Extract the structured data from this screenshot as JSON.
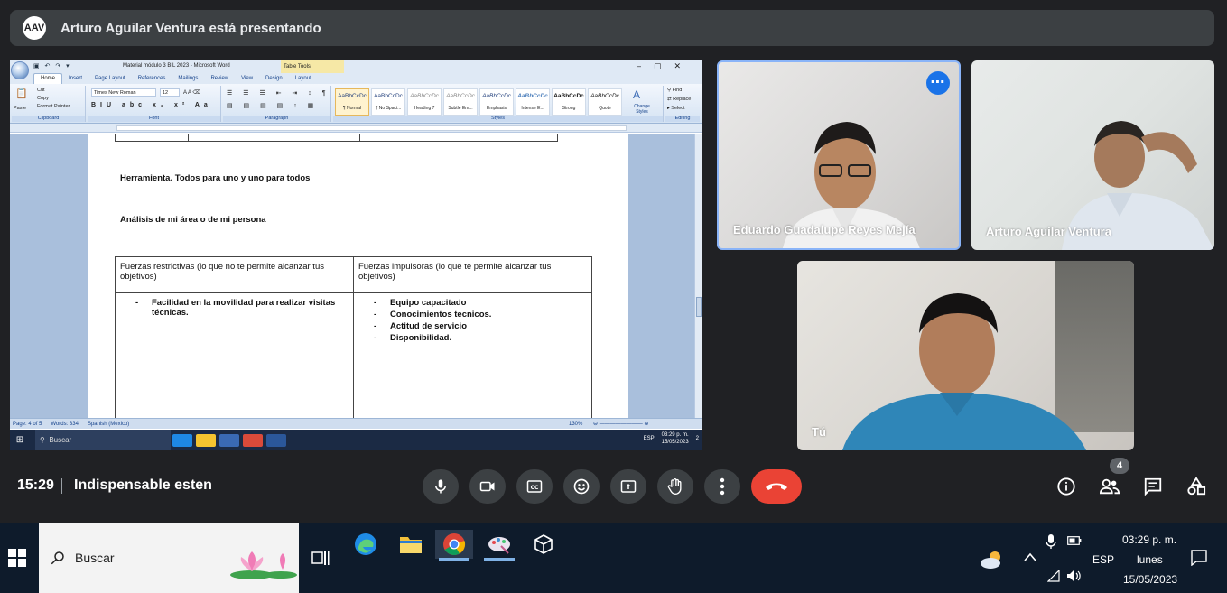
{
  "banner": {
    "presenter_initials": "AAV",
    "text": "Arturo Aguilar Ventura está presentando"
  },
  "word": {
    "window_title": "Material módulo 3 BIL 2023 - Microsoft Word",
    "contextual_tab": "Table Tools",
    "tabs": [
      "Home",
      "Insert",
      "Page Layout",
      "References",
      "Mailings",
      "Review",
      "View",
      "Design",
      "Layout"
    ],
    "active_tab": "Home",
    "clipboard": {
      "paste": "Paste",
      "cut": "Cut",
      "copy": "Copy",
      "format_painter": "Format Painter",
      "label": "Clipboard"
    },
    "font": {
      "name": "Times New Roman",
      "size": "12",
      "label": "Font"
    },
    "paragraph_label": "Paragraph",
    "styles": [
      {
        "preview": "AaBbCcDc",
        "name": "¶ Normal",
        "selected": true
      },
      {
        "preview": "AaBbCcDc",
        "name": "¶ No Spaci...",
        "selected": false
      },
      {
        "preview": "AaBbCcDc",
        "name": "Heading 7",
        "selected": false
      },
      {
        "preview": "AaBbCcDc",
        "name": "Subtle Em...",
        "selected": false
      },
      {
        "preview": "AaBbCcDc",
        "name": "Emphasis",
        "selected": false
      },
      {
        "preview": "AaBbCcDc",
        "name": "Intense E...",
        "selected": false
      },
      {
        "preview": "AaBbCcDc",
        "name": "Strong",
        "selected": false
      },
      {
        "preview": "AaBbCcDc",
        "name": "Quote",
        "selected": false
      }
    ],
    "styles_label": "Styles",
    "change_styles": "Change Styles",
    "editing": {
      "find": "Find",
      "replace": "Replace",
      "select": "Select",
      "label": "Editing"
    },
    "document": {
      "line1": "Herramienta. Todos para uno y uno para todos",
      "line2": "Análisis de mi área o de mi persona",
      "table": {
        "header_left": "Fuerzas restrictivas (lo que no te permite alcanzar tus objetivos)",
        "header_right": "Fuerzas impulsoras (lo que te permite alcanzar tus objetivos)",
        "left_items": [
          "Facilidad en la movilidad para realizar visitas técnicas."
        ],
        "right_items": [
          "Equipo capacitado",
          "Conocimientos tecnicos.",
          "Actitud de servicio",
          "Disponibilidad."
        ]
      }
    },
    "status": {
      "page": "Page: 4 of 5",
      "words": "Words: 334",
      "language": "Spanish (Mexico)",
      "zoom": "130%"
    },
    "inner_taskbar": {
      "search": "Buscar",
      "lang": "ESP",
      "time": "03:29 p. m.",
      "date": "15/05/2023",
      "notif": "2"
    }
  },
  "participants": [
    {
      "name": "Eduardo Guadalupe Reyes Mejía"
    },
    {
      "name": "Arturo Aguilar Ventura"
    },
    {
      "name": "Tú"
    }
  ],
  "controls": {
    "time": "15:29",
    "meeting_name": "Indispensable esten",
    "people_count": "4"
  },
  "taskbar": {
    "search_placeholder": "Buscar",
    "lang": "ESP",
    "time": "03:29 p. m.",
    "day": "lunes",
    "date": "15/05/2023"
  }
}
